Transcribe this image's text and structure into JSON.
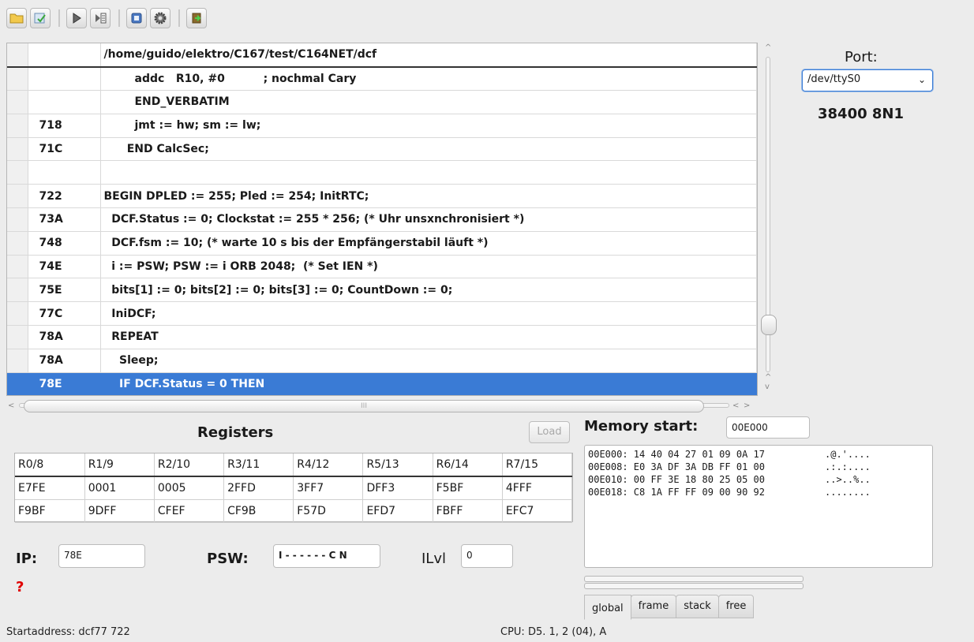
{
  "toolbar": {
    "buttons": [
      {
        "name": "open-folder-icon"
      },
      {
        "name": "reload-icon"
      },
      {
        "name": "run-icon"
      },
      {
        "name": "step-into-icon"
      },
      {
        "name": "stop-icon"
      },
      {
        "name": "settings-gear-icon"
      },
      {
        "name": "exit-icon"
      }
    ]
  },
  "source": {
    "file_path": "/home/guido/elektro/C167/test/C164NET/dcf",
    "rows": [
      {
        "addr": "",
        "code": "        addc   R10, #0          ; nochmal Cary"
      },
      {
        "addr": "",
        "code": "        END_VERBATIM"
      },
      {
        "addr": "718",
        "code": "        jmt := hw; sm := lw;"
      },
      {
        "addr": "71C",
        "code": "      END CalcSec;"
      },
      {
        "addr": "",
        "code": ""
      },
      {
        "addr": "722",
        "code": "BEGIN DPLED := 255; Pled := 254; InitRTC;"
      },
      {
        "addr": "73A",
        "code": "  DCF.Status := 0; Clockstat := 255 * 256; (* Uhr unsxnchronisiert *)"
      },
      {
        "addr": "748",
        "code": "  DCF.fsm := 10; (* warte 10 s bis der Empfängerstabil läuft *)"
      },
      {
        "addr": "74E",
        "code": "  i := PSW; PSW := i ORB 2048;  (* Set IEN *)"
      },
      {
        "addr": "75E",
        "code": "  bits[1] := 0; bits[2] := 0; bits[3] := 0; CountDown := 0;"
      },
      {
        "addr": "77C",
        "code": "  IniDCF;"
      },
      {
        "addr": "78A",
        "code": "  REPEAT"
      },
      {
        "addr": "78A",
        "code": "    Sleep;"
      },
      {
        "addr": "78E",
        "code": "    IF DCF.Status = 0 THEN"
      }
    ]
  },
  "hscroll": {
    "thumb_marker": "III"
  },
  "port": {
    "label": "Port:",
    "device": "/dev/ttyS0",
    "settings": "38400 8N1"
  },
  "registers": {
    "title": "Registers",
    "load_label": "Load",
    "headers": [
      "R0/8",
      "R1/9",
      "R2/10",
      "R3/11",
      "R4/12",
      "R5/13",
      "R6/14",
      "R7/15"
    ],
    "rows": [
      [
        "E7FE",
        "0001",
        "0005",
        "2FFD",
        "3FF7",
        "DFF3",
        "F5BF",
        "4FFF"
      ],
      [
        "F9BF",
        "9DFF",
        "CFEF",
        "CF9B",
        "F57D",
        "EFD7",
        "FBFF",
        "EFC7"
      ]
    ]
  },
  "cpu": {
    "ip_label": "IP:",
    "ip_value": "78E",
    "psw_label": "PSW:",
    "psw_value": "I - - - - - - C N",
    "ilvl_label": "ILvl",
    "ilvl_value": "0",
    "status_mark": "?"
  },
  "memory": {
    "title": "Memory start:",
    "start": "00E000",
    "lines": [
      {
        "hex": "00E000: 14 40 04 27 01 09 0A 17",
        "ascii": ".@.'...."
      },
      {
        "hex": "00E008: E0 3A DF 3A DB FF 01 00",
        "ascii": ".:.:...."
      },
      {
        "hex": "00E010: 00 FF 3E 18 80 25 05 00",
        "ascii": "..>..%.."
      },
      {
        "hex": "00E018: C8 1A FF FF 09 00 90 92",
        "ascii": "........"
      }
    ],
    "tabs": [
      "global",
      "frame",
      "stack",
      "free"
    ]
  },
  "statusbar": {
    "left": "Startaddress: dcf77   722",
    "right": "CPU: D5. 1, 2 (04), A"
  }
}
